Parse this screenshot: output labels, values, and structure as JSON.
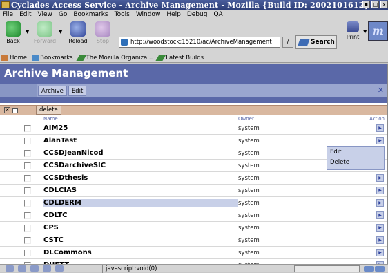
{
  "window": {
    "title": "Cyclades Access Service - Archive Management - Mozilla {Build ID: 2002101612}"
  },
  "menu": [
    "File",
    "Edit",
    "View",
    "Go",
    "Bookmarks",
    "Tools",
    "Window",
    "Help",
    "Debug",
    "QA"
  ],
  "nav": {
    "back": "Back",
    "forward": "Forward",
    "reload": "Reload",
    "stop": "Stop",
    "url": "http://woodstock:15210/ac/ArchiveManagement",
    "search": "Search",
    "print": "Print",
    "brand_glyph": "m"
  },
  "personal": [
    "Home",
    "Bookmarks",
    "The Mozilla Organiza...",
    "Latest Builds"
  ],
  "page": {
    "title": "Archive Management",
    "tabs": [
      "Archive",
      "Edit"
    ],
    "close_glyph": "✕",
    "action": "delete",
    "columns": {
      "name": "Name",
      "owner": "Owner",
      "action": "Action"
    },
    "rows": [
      {
        "name": "AIM25",
        "owner": "system"
      },
      {
        "name": "AlanTest",
        "owner": "system"
      },
      {
        "name": "CCSDJeanNicod",
        "owner": "system"
      },
      {
        "name": "CCSDarchiveSIC",
        "owner": "system"
      },
      {
        "name": "CCSDthesis",
        "owner": "system"
      },
      {
        "name": "CDLCIAS",
        "owner": "system"
      },
      {
        "name": "CDLDERM",
        "owner": "system"
      },
      {
        "name": "CDLTC",
        "owner": "system"
      },
      {
        "name": "CPS",
        "owner": "system"
      },
      {
        "name": "CSTC",
        "owner": "system"
      },
      {
        "name": "DLCommons",
        "owner": "system"
      },
      {
        "name": "DUETT",
        "owner": "system"
      }
    ],
    "popup": [
      "Edit",
      "Delete"
    ]
  },
  "status": {
    "text": "javascript:void(0)"
  }
}
